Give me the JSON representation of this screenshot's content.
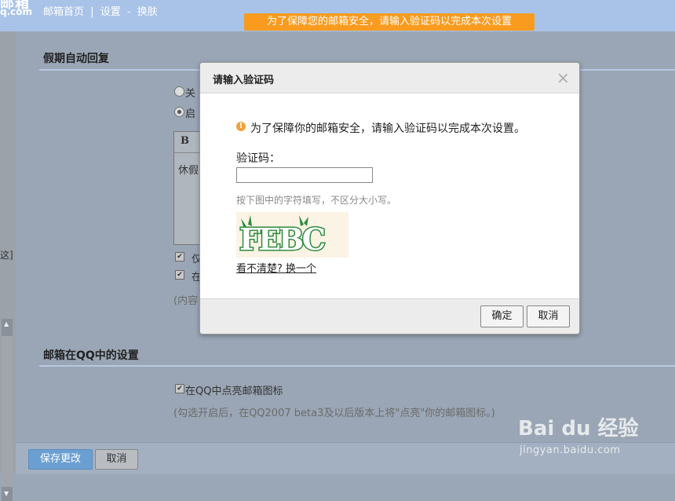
{
  "header": {
    "logo_cn": "邮箱",
    "logo_en": "q.com",
    "nav": [
      "邮箱首页",
      "设置",
      "换肤"
    ],
    "nav_sep1": "|",
    "nav_sep2": "-",
    "banner": "为了保障您的邮箱安全，请输入验证码以完成本次设置"
  },
  "sidebar": {
    "hint": "这]"
  },
  "vacation": {
    "title": "假期自动回复",
    "off_label": "关",
    "on_label": "启",
    "editor_bold": "B",
    "editor_text": "休假",
    "opt1_label": "仅",
    "opt2_label": "在",
    "note": "(内容"
  },
  "qq_section": {
    "title": "邮箱在QQ中的设置",
    "checkbox_label": "在QQ中点亮邮箱图标",
    "note": "(勾选开启后，在QQ2007 beta3及以后版本上将\"点亮\"你的邮箱图标。)"
  },
  "footer": {
    "save_label": "保存更改",
    "cancel_label": "取消"
  },
  "dialog": {
    "title": "请输入验证码",
    "close": "×",
    "warn_icon": "!",
    "message": "为了保障你的邮箱安全，请输入验证码以完成本次设置。",
    "code_label": "验证码：",
    "code_value": "",
    "hint": "按下图中的字符填写，不区分大小写。",
    "captcha_text": "FEBC",
    "change_link": "看不清楚? 换一个",
    "ok_label": "确定",
    "cancel_label": "取消"
  },
  "watermark": {
    "logo": "Bai du 经验",
    "site": "jingyan.baidu.com"
  },
  "colors": {
    "banner": "#f89b1e",
    "header": "#a9c3e8",
    "save_button": "#6b9fd1",
    "warn_icon": "#f0a23a",
    "captcha_green": "#2e8b3e"
  }
}
